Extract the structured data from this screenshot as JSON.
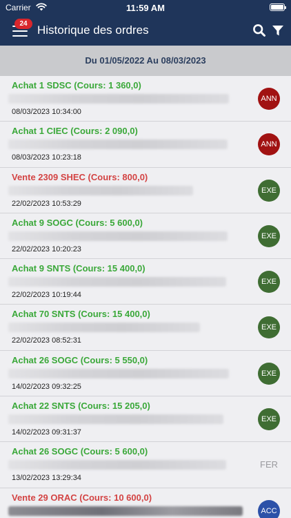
{
  "status_bar": {
    "carrier": "Carrier",
    "time": "11:59 AM"
  },
  "header": {
    "badge": "24",
    "title": "Historique des ordres"
  },
  "date_range": "Du 01/05/2022 Au 08/03/2023",
  "orders": [
    {
      "title": "Achat 1 SDSC (Cours: 1 360,0)",
      "date": "08/03/2023 10:34:00",
      "status": "ANN"
    },
    {
      "title": "Achat 1 CIEC (Cours: 2 090,0)",
      "date": "08/03/2023 10:23:18",
      "status": "ANN"
    },
    {
      "title": "Vente 2309 SHEC (Cours: 800,0)",
      "date": "22/02/2023 10:53:29",
      "status": "EXE"
    },
    {
      "title": "Achat 9 SOGC (Cours: 5 600,0)",
      "date": "22/02/2023 10:20:23",
      "status": "EXE"
    },
    {
      "title": "Achat 9 SNTS (Cours: 15 400,0)",
      "date": "22/02/2023 10:19:44",
      "status": "EXE"
    },
    {
      "title": "Achat 70 SNTS (Cours: 15 400,0)",
      "date": "22/02/2023 08:52:31",
      "status": "EXE"
    },
    {
      "title": "Achat 26 SOGC (Cours: 5 550,0)",
      "date": "14/02/2023 09:32:25",
      "status": "EXE"
    },
    {
      "title": "Achat 22 SNTS (Cours: 15 205,0)",
      "date": "14/02/2023 09:31:37",
      "status": "EXE"
    },
    {
      "title": "Achat 26 SOGC (Cours: 5 600,0)",
      "date": "13/02/2023 13:29:34",
      "status": "FER"
    },
    {
      "title": "Vente 29 ORAC (Cours: 10 600,0)",
      "date": "",
      "status": "ACC"
    }
  ]
}
